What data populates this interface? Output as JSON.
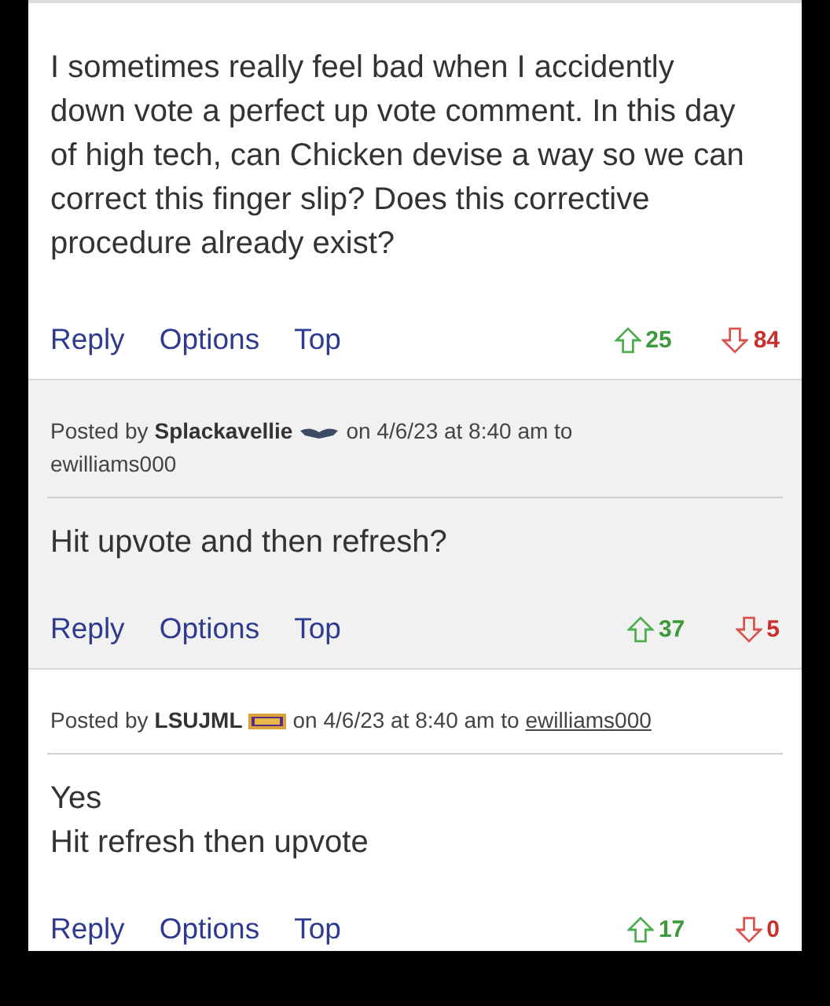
{
  "posts": [
    {
      "shaded": false,
      "body": [
        "I sometimes really feel bad when I accidently down vote a perfect up vote comment. In this day of high tech, can Chicken devise a way so we can correct this finger slip? Does this corrective procedure already exist?"
      ],
      "actions": [
        "Reply",
        "Options",
        "Top"
      ],
      "upvotes": "25",
      "downvotes": "84"
    },
    {
      "shaded": true,
      "header": {
        "prefix": "Posted by",
        "author": "Splackavellie",
        "badge": {
          "kind": "wings"
        },
        "date": "on 4/6/23 at 8:40 am to",
        "reply_to": "ewilliams000",
        "reply_link": false
      },
      "body": [
        "Hit upvote and then refresh?"
      ],
      "actions": [
        "Reply",
        "Options",
        "Top"
      ],
      "upvotes": "37",
      "downvotes": "5"
    },
    {
      "shaded": false,
      "header": {
        "prefix": "Posted by",
        "author": "LSUJML",
        "badge": {
          "kind": "flag"
        },
        "date": "on 4/6/23 at 8:40 am to",
        "reply_to": "ewilliams000",
        "reply_link": true
      },
      "body": [
        "Yes",
        "Hit refresh then upvote"
      ],
      "actions": [
        "Reply",
        "Options",
        "Top"
      ],
      "upvotes": "17",
      "downvotes": "0"
    }
  ]
}
